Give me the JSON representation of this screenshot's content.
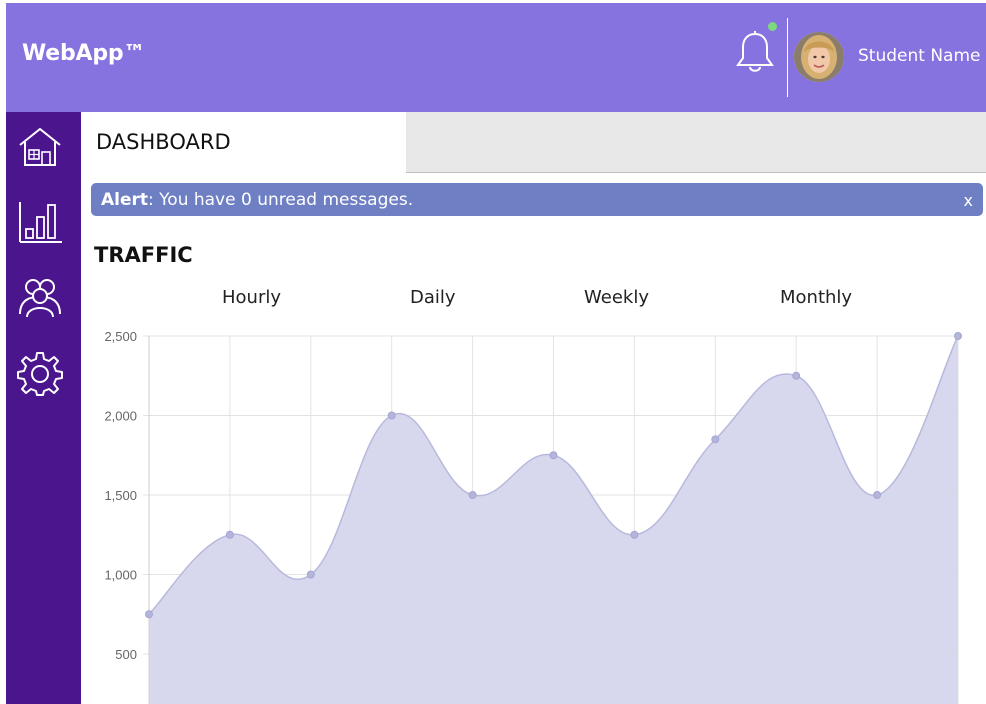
{
  "header": {
    "brand": "WebApp™",
    "user_name": "Student Name",
    "notification_dot_color": "#7ed87e"
  },
  "sidebar": {
    "items": [
      {
        "icon": "home-icon"
      },
      {
        "icon": "bar-chart-icon"
      },
      {
        "icon": "users-icon"
      },
      {
        "icon": "gear-icon"
      }
    ]
  },
  "tabs": {
    "active_label": "DASHBOARD"
  },
  "alert": {
    "title": "Alert",
    "message": ": You have 0 unread messages.",
    "close_label": "x"
  },
  "traffic": {
    "title": "TRAFFIC",
    "ranges": [
      "Hourly",
      "Daily",
      "Weekly",
      "Monthly"
    ]
  },
  "colors": {
    "header": "#8773e0",
    "sidebar": "#4b158d",
    "alert": "#6f7fc4",
    "chart_fill": "#d5d6ec",
    "chart_line": "#b8b9dc"
  },
  "chart_data": {
    "type": "area",
    "y_ticks": [
      "2,500",
      "2,000",
      "1,500",
      "1,000",
      "500"
    ],
    "y_tick_values": [
      2500,
      2000,
      1500,
      1000,
      500
    ],
    "ylim": [
      250,
      2500
    ],
    "grid": true,
    "series": [
      {
        "values": [
          750,
          1250,
          1000,
          2000,
          1500,
          1750,
          1250,
          1850,
          2250,
          1500,
          2500
        ]
      }
    ]
  }
}
